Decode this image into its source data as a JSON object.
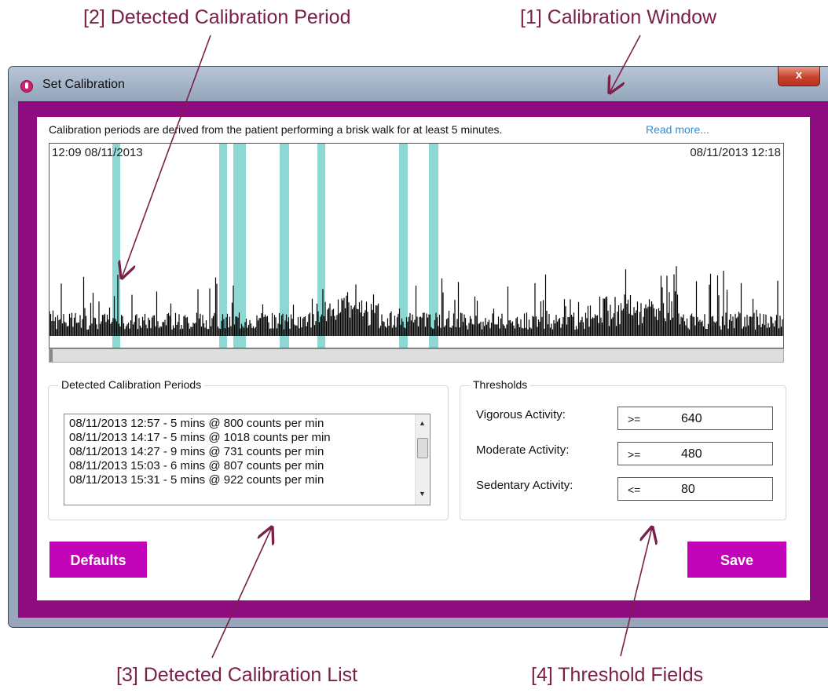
{
  "callouts": {
    "c1": "[1] Calibration Window",
    "c2": "[2] Detected Calibration Period",
    "c3": "[3] Detected Calibration List",
    "c4": "[4] Threshold Fields"
  },
  "window": {
    "title": "Set Calibration",
    "close_glyph": "x",
    "icon": "app-logo-icon"
  },
  "info": {
    "text": "Calibration periods are derived from the patient performing a brisk walk for at least 5 minutes.",
    "read_more": "Read more..."
  },
  "chart": {
    "start_label": "12:09 08/11/2013",
    "end_label": "08/11/2013 12:18",
    "highlight_color": "#8ed8d4",
    "bar_color": "#000000"
  },
  "periods": {
    "title": "Detected Calibration Periods",
    "items": [
      "08/11/2013 12:57 - 5 mins @ 800 counts per min",
      "08/11/2013 14:17 - 5 mins @ 1018 counts per min",
      "08/11/2013 14:27 - 9 mins @ 731 counts per min",
      "08/11/2013 15:03 - 6 mins @ 807 counts per min",
      "08/11/2013 15:31 - 5 mins @ 922 counts per min"
    ]
  },
  "thresholds": {
    "title": "Thresholds",
    "vigorous": {
      "label": "Vigorous Activity:",
      "op": ">=",
      "value": "640"
    },
    "moderate": {
      "label": "Moderate Activity:",
      "op": ">=",
      "value": "480"
    },
    "sedentary": {
      "label": "Sedentary Activity:",
      "op": "<=",
      "value": "80"
    }
  },
  "buttons": {
    "defaults": "Defaults",
    "save": "Save"
  },
  "colors": {
    "frame": "#8e0b80",
    "button": "#c104b7",
    "callout": "#7b2048",
    "link": "#2a8fe0"
  }
}
